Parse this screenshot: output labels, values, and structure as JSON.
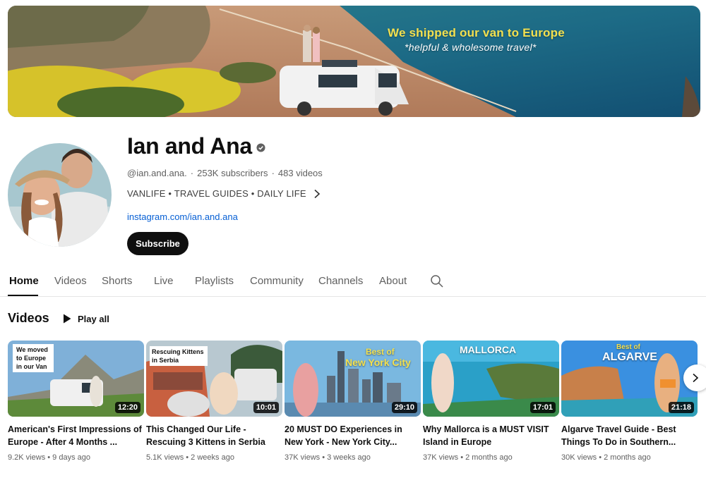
{
  "banner": {
    "headline": "We shipped our van to Europe",
    "subtitle": "*helpful & wholesome travel*"
  },
  "channel": {
    "name": "Ian and Ana",
    "handle": "@ian.and.ana.",
    "subscribers": "253K subscribers",
    "videos_count": "483 videos",
    "separator": "·",
    "tags": "VANLIFE • TRAVEL GUIDES • DAILY LIFE",
    "link": "instagram.com/ian.and.ana",
    "subscribe_label": "Subscribe"
  },
  "tabs": [
    {
      "label": "Home",
      "active": true
    },
    {
      "label": "Videos"
    },
    {
      "label": "Shorts"
    },
    {
      "label": "Live"
    },
    {
      "label": "Playlists"
    },
    {
      "label": "Community"
    },
    {
      "label": "Channels"
    },
    {
      "label": "About"
    }
  ],
  "section": {
    "title": "Videos",
    "play_all": "Play all"
  },
  "videos": [
    {
      "title": "American's First Impressions of Europe - After 4 Months ...",
      "views": "9.2K views",
      "age": "9 days ago",
      "duration": "12:20",
      "thumb_text": [
        "We moved",
        "to Europe",
        "in our Van"
      ]
    },
    {
      "title": "This Changed Our Life - Rescuing 3 Kittens in Serbia",
      "views": "5.1K views",
      "age": "2 weeks ago",
      "duration": "10:01",
      "thumb_text": [
        "Rescuing Kittens",
        "in Serbia"
      ]
    },
    {
      "title": "20 MUST DO Experiences in New York - New York City...",
      "views": "37K views",
      "age": "3 weeks ago",
      "duration": "29:10",
      "thumb_text": [
        "Best of",
        "New York City"
      ]
    },
    {
      "title": "Why Mallorca is a MUST VISIT Island in Europe",
      "views": "37K views",
      "age": "2 months ago",
      "duration": "17:01",
      "thumb_text": [
        "MALLORCA"
      ]
    },
    {
      "title": "Algarve Travel Guide - Best Things To Do in Southern...",
      "views": "30K views",
      "age": "2 months ago",
      "duration": "21:18",
      "thumb_text": [
        "Best of",
        "ALGARVE"
      ]
    }
  ],
  "colors": {
    "link": "#065fd4",
    "banner_headline": "#f3e04f",
    "subscribe_bg": "#0f0f0f"
  }
}
